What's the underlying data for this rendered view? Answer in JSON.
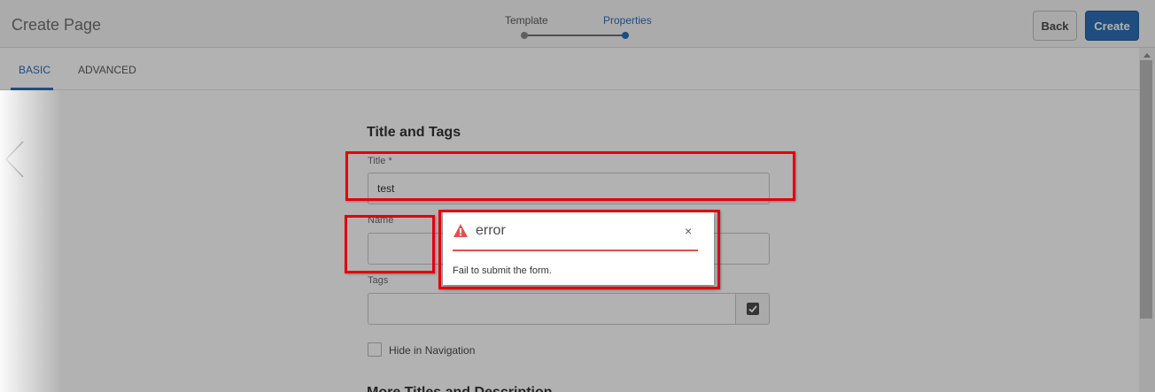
{
  "header": {
    "app_title": "Create Page",
    "steps": [
      {
        "label": "Template",
        "status": "completed"
      },
      {
        "label": "Properties",
        "status": "current"
      }
    ],
    "back_label": "Back",
    "create_label": "Create"
  },
  "tabs": [
    {
      "label": "BASIC",
      "active": true
    },
    {
      "label": "ADVANCED",
      "active": false
    }
  ],
  "form": {
    "section_title": "Title and Tags",
    "title_label": "Title *",
    "title_value": "test",
    "name_label": "Name",
    "name_value": "",
    "tags_label": "Tags",
    "tags_value": "",
    "hide_nav_label": "Hide in Navigation",
    "hide_nav_checked": false,
    "next_section_title": "More Titles and Description"
  },
  "dialog": {
    "title": "error",
    "message": "Fail to submit the form.",
    "close_glyph": "×"
  },
  "colors": {
    "accent": "#2d6fb6",
    "error": "#e0524f",
    "highlight": "#e3000f"
  },
  "icons": {
    "previous": "chevron-left-icon",
    "tags_picker": "checkmark-icon",
    "dialog_status": "alert-triangle-icon",
    "dialog_close": "close-icon"
  }
}
